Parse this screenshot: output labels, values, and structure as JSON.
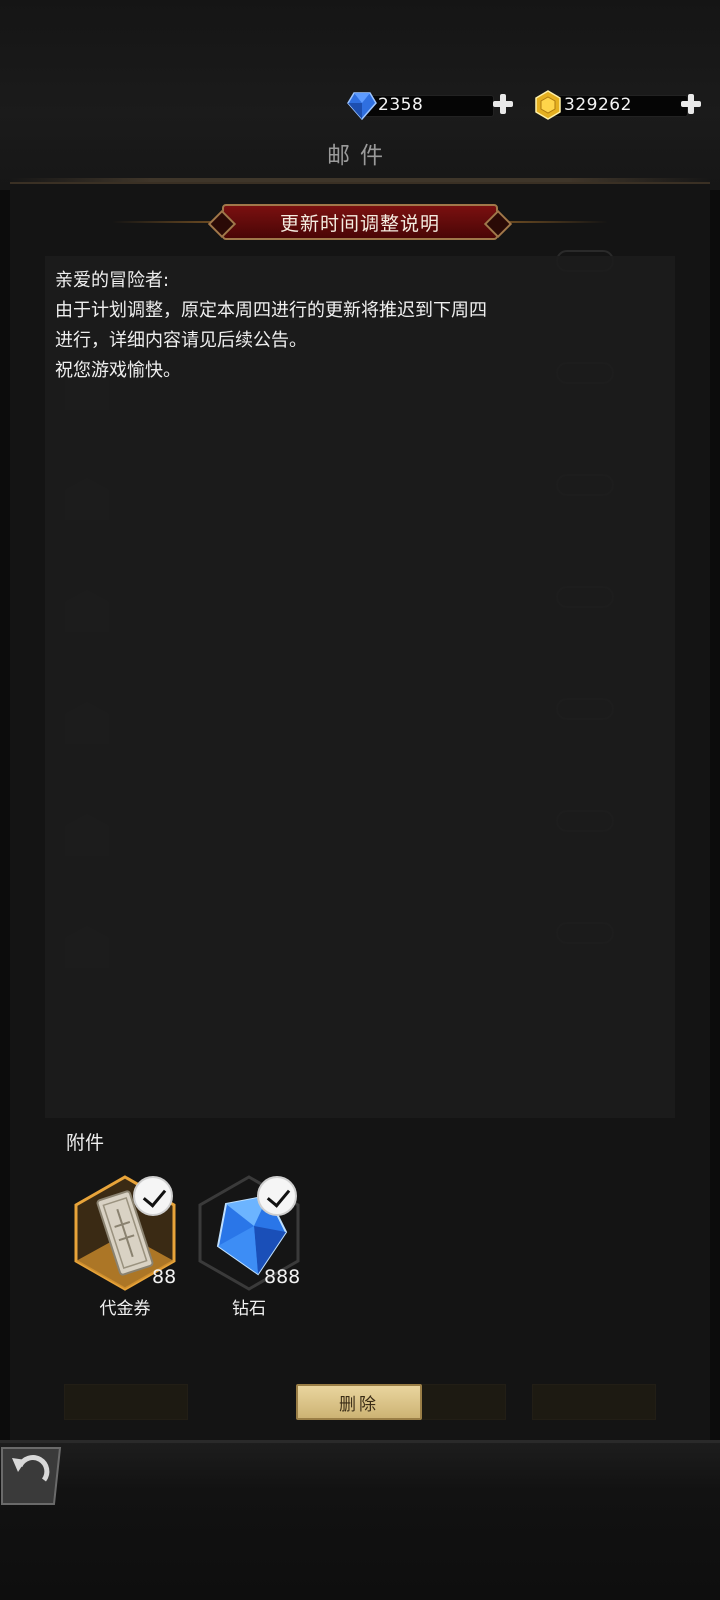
{
  "currency": {
    "diamond_value": "2358",
    "gold_value": "329262",
    "diamond_icon": "blue-gem-icon",
    "gold_icon": "gold-coin-icon"
  },
  "page": {
    "title": "邮件"
  },
  "mail_dialog": {
    "title": "更新时间调整说明",
    "body_lines": [
      "亲爱的冒险者:",
      "由于计划调整，原定本周四进行的更新将推迟到下周四",
      "进行，详细内容请见后续公告。",
      "祝您游戏愉快。"
    ]
  },
  "attachments": {
    "label": "附件",
    "items": [
      {
        "name": "代金券",
        "count": "88",
        "icon": "voucher-icon"
      },
      {
        "name": "钻石",
        "count": "888",
        "icon": "diamond-icon"
      }
    ]
  },
  "actions": {
    "delete_label": "删除"
  },
  "colors": {
    "accent_red": "#7a1010",
    "gold_border": "#a0784a",
    "button_gold": "#e9d59e",
    "rarity_orange": "#e8a43a"
  }
}
